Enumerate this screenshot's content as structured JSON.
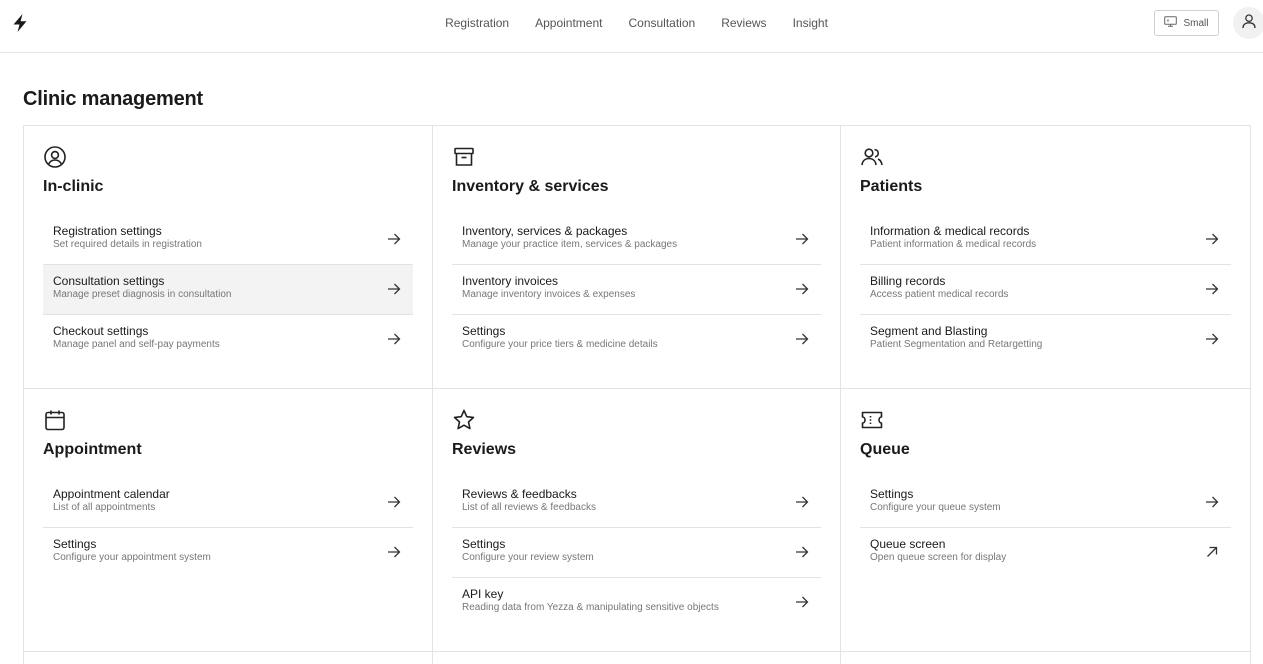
{
  "header": {
    "logo_icon": "bolt-icon",
    "nav": [
      {
        "label": "Registration"
      },
      {
        "label": "Appointment"
      },
      {
        "label": "Consultation"
      },
      {
        "label": "Reviews"
      },
      {
        "label": "Insight"
      }
    ],
    "size_button": {
      "label": "Small",
      "icon": "monitor-icon"
    },
    "avatar_icon": "user-icon"
  },
  "page": {
    "title": "Clinic management"
  },
  "sections": [
    {
      "icon": "user-circle-icon",
      "title": "In-clinic",
      "items": [
        {
          "title": "Registration settings",
          "subtitle": "Set required details in registration"
        },
        {
          "title": "Consultation settings",
          "subtitle": "Manage preset diagnosis in consultation"
        },
        {
          "title": "Checkout settings",
          "subtitle": "Manage panel and self-pay payments"
        }
      ]
    },
    {
      "icon": "archive-icon",
      "title": "Inventory & services",
      "items": [
        {
          "title": "Inventory, services & packages",
          "subtitle": "Manage your practice item, services & packages"
        },
        {
          "title": "Inventory invoices",
          "subtitle": "Manage inventory invoices & expenses"
        },
        {
          "title": "Settings",
          "subtitle": "Configure your price tiers & medicine details"
        }
      ]
    },
    {
      "icon": "users-icon",
      "title": "Patients",
      "items": [
        {
          "title": "Information & medical records",
          "subtitle": "Patient information & medical records"
        },
        {
          "title": "Billing records",
          "subtitle": "Access patient medical records"
        },
        {
          "title": "Segment and Blasting",
          "subtitle": "Patient Segmentation and Retargetting"
        }
      ]
    },
    {
      "icon": "calendar-icon",
      "title": "Appointment",
      "items": [
        {
          "title": "Appointment calendar",
          "subtitle": "List of all appointments"
        },
        {
          "title": "Settings",
          "subtitle": "Configure your appointment system"
        }
      ]
    },
    {
      "icon": "star-icon",
      "title": "Reviews",
      "items": [
        {
          "title": "Reviews & feedbacks",
          "subtitle": "List of all reviews & feedbacks"
        },
        {
          "title": "Settings",
          "subtitle": "Configure your review system"
        },
        {
          "title": "API key",
          "subtitle": "Reading data from Yezza & manipulating sensitive objects"
        }
      ]
    },
    {
      "icon": "ticket-icon",
      "title": "Queue",
      "items": [
        {
          "title": "Settings",
          "subtitle": "Configure your queue system"
        },
        {
          "title": "Queue screen",
          "subtitle": "Open queue screen for display"
        }
      ]
    }
  ]
}
